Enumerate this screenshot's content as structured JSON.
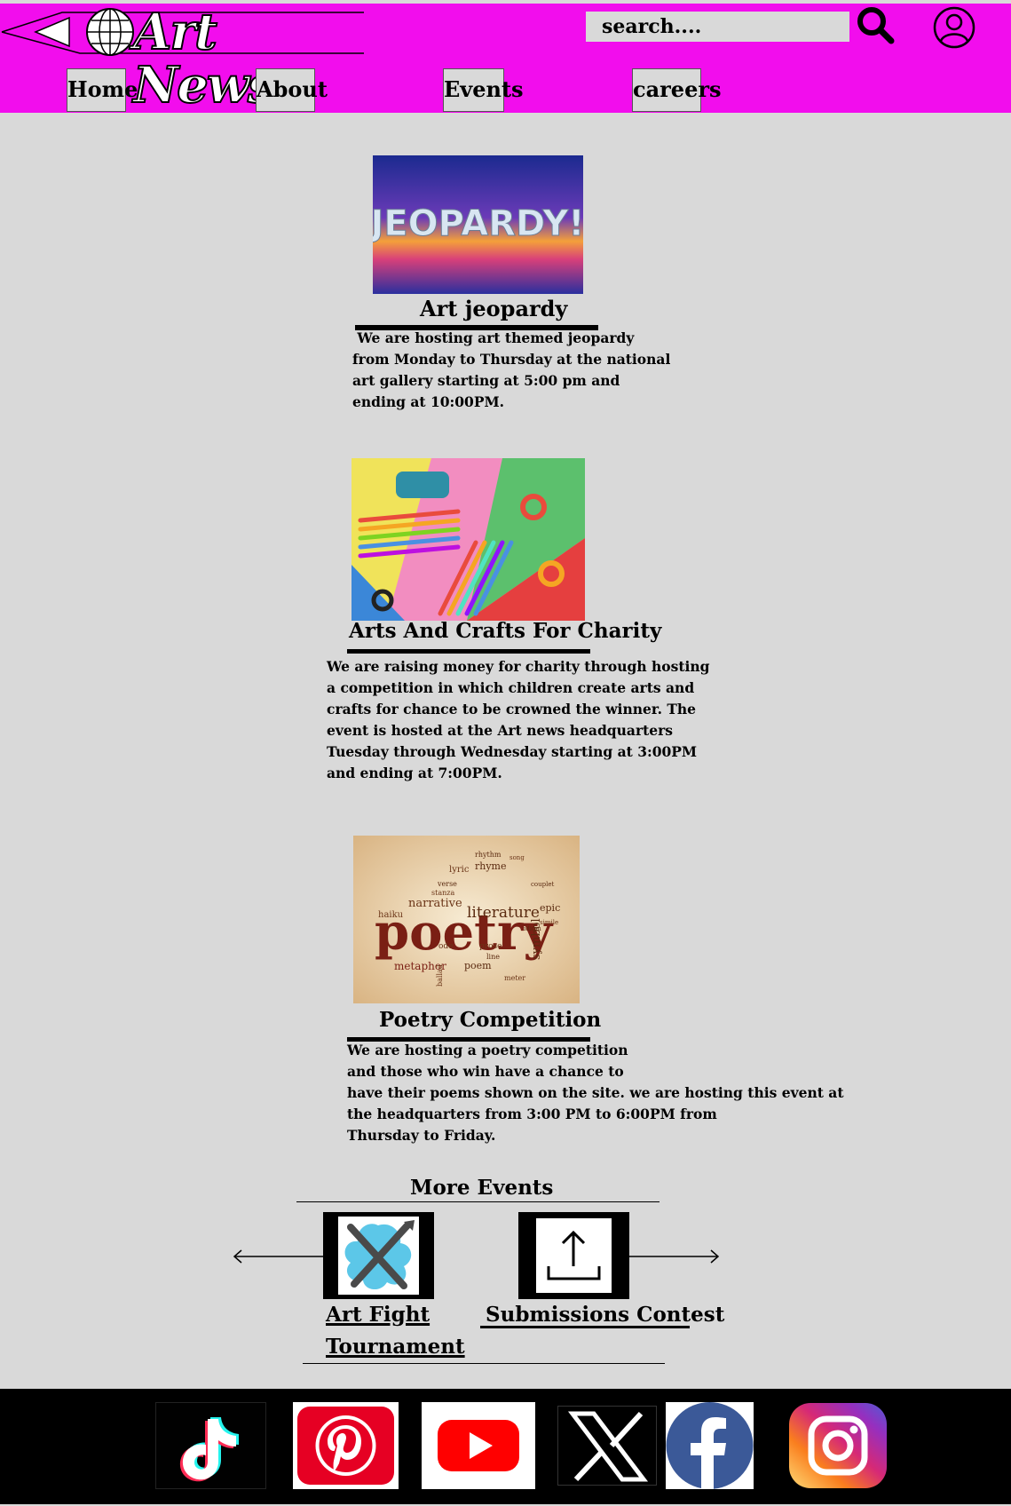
{
  "header": {
    "logo_text": "Art News",
    "search_placeholder": "search....",
    "colors": {
      "bar": "#f20ded",
      "page": "#d9d9d9"
    },
    "icons": [
      "search-icon",
      "user-account-icon"
    ]
  },
  "nav": {
    "items": [
      {
        "label": "Home"
      },
      {
        "label": "About"
      },
      {
        "label": "Events"
      },
      {
        "label": "careers"
      }
    ]
  },
  "events": [
    {
      "title": "Art jeopardy",
      "image_text": "JEOPARDY!",
      "description": " We are hosting art themed jeopardy\nfrom Monday to Thursday at the national\nart gallery starting at 5:00 pm and\nending at 10:00PM."
    },
    {
      "title": "Arts And Crafts For Charity",
      "description": "We are raising money for charity through hosting\na competition in which children create arts and\ncrafts for chance to be crowned the winner. The\nevent is hosted at the Art news headquarters\nTuesday through Wednesday starting at 3:00PM\nand ending at 7:00PM."
    },
    {
      "title": "Poetry Competition",
      "image_words": [
        "poetry",
        "literature",
        "narrative",
        "rhyme",
        "lyric",
        "metaphor",
        "symbol",
        "haiku",
        "verse",
        "stanza",
        "epic",
        "ode",
        "poem",
        "prose",
        "line",
        "meter",
        "rhythm",
        "song",
        "couplet",
        "ballad",
        "idiom",
        "simile"
      ],
      "description": "We are hosting a poetry competition\nand those who win have a chance to\nhave their poems shown on the site. we are hosting this event at\nthe headquarters from 3:00 PM to 6:00PM from\nThursday to Friday."
    }
  ],
  "more_events": {
    "heading": "More Events",
    "items": [
      {
        "label_line1": "Art Fight",
        "label_line2": "Tournament",
        "icon": "crossed-brushes-icon"
      },
      {
        "label": "Submissions Contest",
        "icon": "upload-icon"
      }
    ],
    "arrows": [
      "arrow-left-icon",
      "arrow-right-icon"
    ]
  },
  "footer": {
    "socials": [
      {
        "name": "TikTok",
        "icon": "tiktok-icon"
      },
      {
        "name": "Pinterest",
        "icon": "pinterest-icon",
        "color": "#e60023"
      },
      {
        "name": "YouTube",
        "icon": "youtube-icon",
        "color": "#ff0000"
      },
      {
        "name": "X",
        "icon": "x-icon"
      },
      {
        "name": "Facebook",
        "icon": "facebook-icon",
        "color": "#3b5998"
      },
      {
        "name": "Instagram",
        "icon": "instagram-icon"
      }
    ]
  }
}
